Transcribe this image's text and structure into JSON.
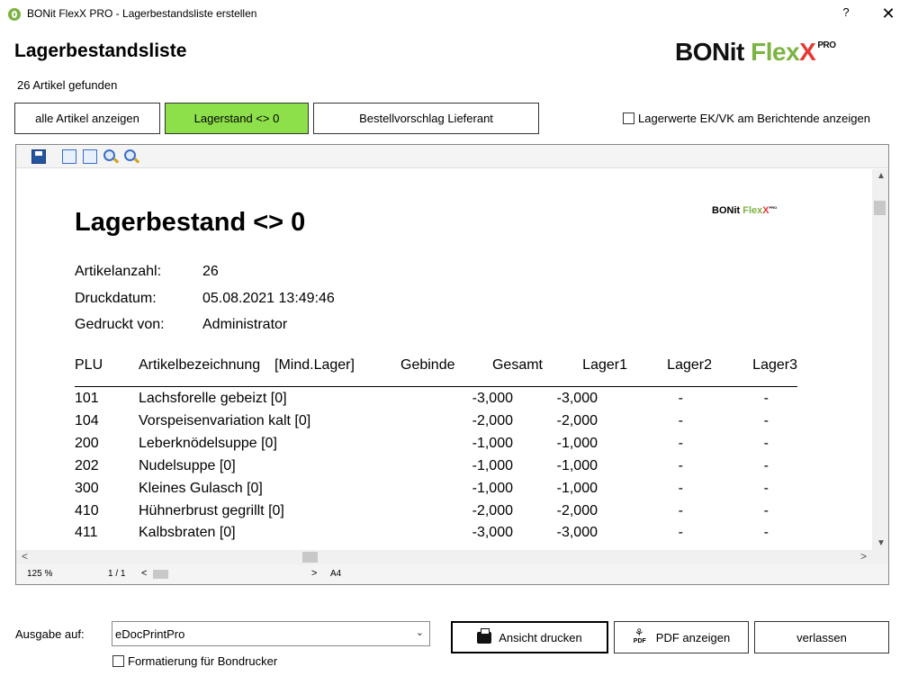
{
  "window": {
    "title": "BONit FlexX PRO - Lagerbestandsliste erstellen",
    "help_label": "?",
    "close_label": "✕"
  },
  "header": {
    "title": "Lagerbestandsliste",
    "found_text": "26 Artikel gefunden"
  },
  "brand": {
    "bonit": "BONit ",
    "flex": "Flex",
    "x": "X",
    "pro": "PRO"
  },
  "filters": {
    "all_label": "alle Artikel anzeigen",
    "lagerstand_label": "Lagerstand <> 0",
    "bestell_label": "Bestellvorschlag Lieferant",
    "active_color": "#8ee04a"
  },
  "options": {
    "ekvk_label": "Lagerwerte EK/VK am Berichtende anzeigen"
  },
  "report": {
    "title": "Lagerbestand <> 0",
    "logo": {
      "bonit": "BONit ",
      "flex": "Flex",
      "x": "X",
      "pro": "PRO"
    },
    "meta": [
      {
        "label": "Artikelanzahl:",
        "value": "26"
      },
      {
        "label": "Druckdatum:",
        "value": "05.08.2021   13:49:46"
      },
      {
        "label": "Gedruckt  von:",
        "value": "Administrator"
      }
    ],
    "columns": {
      "plu": "PLU",
      "name": "Artikelbezeichnung",
      "min": "[Mind.Lager]",
      "gebinde": "Gebinde",
      "gesamt": "Gesamt",
      "lager1": "Lager1",
      "lager2": "Lager2",
      "lager3": "Lager3"
    },
    "rows": [
      {
        "plu": "101",
        "name": "Lachsforelle  gebeizt  [0]",
        "gesamt": "-3,000",
        "lager1": "-3,000",
        "lager2": "-",
        "lager3": "-"
      },
      {
        "plu": "104",
        "name": "Vorspeisenvariation  kalt  [0]",
        "gesamt": "-2,000",
        "lager1": "-2,000",
        "lager2": "-",
        "lager3": "-"
      },
      {
        "plu": "200",
        "name": "Leberknödelsuppe  [0]",
        "gesamt": "-1,000",
        "lager1": "-1,000",
        "lager2": "-",
        "lager3": "-"
      },
      {
        "plu": "202",
        "name": "Nudelsuppe  [0]",
        "gesamt": "-1,000",
        "lager1": "-1,000",
        "lager2": "-",
        "lager3": "-"
      },
      {
        "plu": "300",
        "name": "Kleines  Gulasch  [0]",
        "gesamt": "-1,000",
        "lager1": "-1,000",
        "lager2": "-",
        "lager3": "-"
      },
      {
        "plu": "410",
        "name": "Hühnerbrust  gegrillt  [0]",
        "gesamt": "-2,000",
        "lager1": "-2,000",
        "lager2": "-",
        "lager3": "-"
      },
      {
        "plu": "411",
        "name": "Kalbsbraten  [0]",
        "gesamt": "-3,000",
        "lager1": "-3,000",
        "lager2": "-",
        "lager3": "-"
      }
    ]
  },
  "viewer_status": {
    "zoom": "125 %",
    "page": "1 / 1",
    "paper": "A4"
  },
  "output": {
    "label": "Ausgabe auf:",
    "printer": "eDocPrintPro",
    "bon_label": "Formatierung für Bondrucker"
  },
  "actions": {
    "print_label": "Ansicht drucken",
    "pdf_label": "PDF anzeigen",
    "pdf_icon_text": "PDF",
    "exit_label": "verlassen"
  }
}
